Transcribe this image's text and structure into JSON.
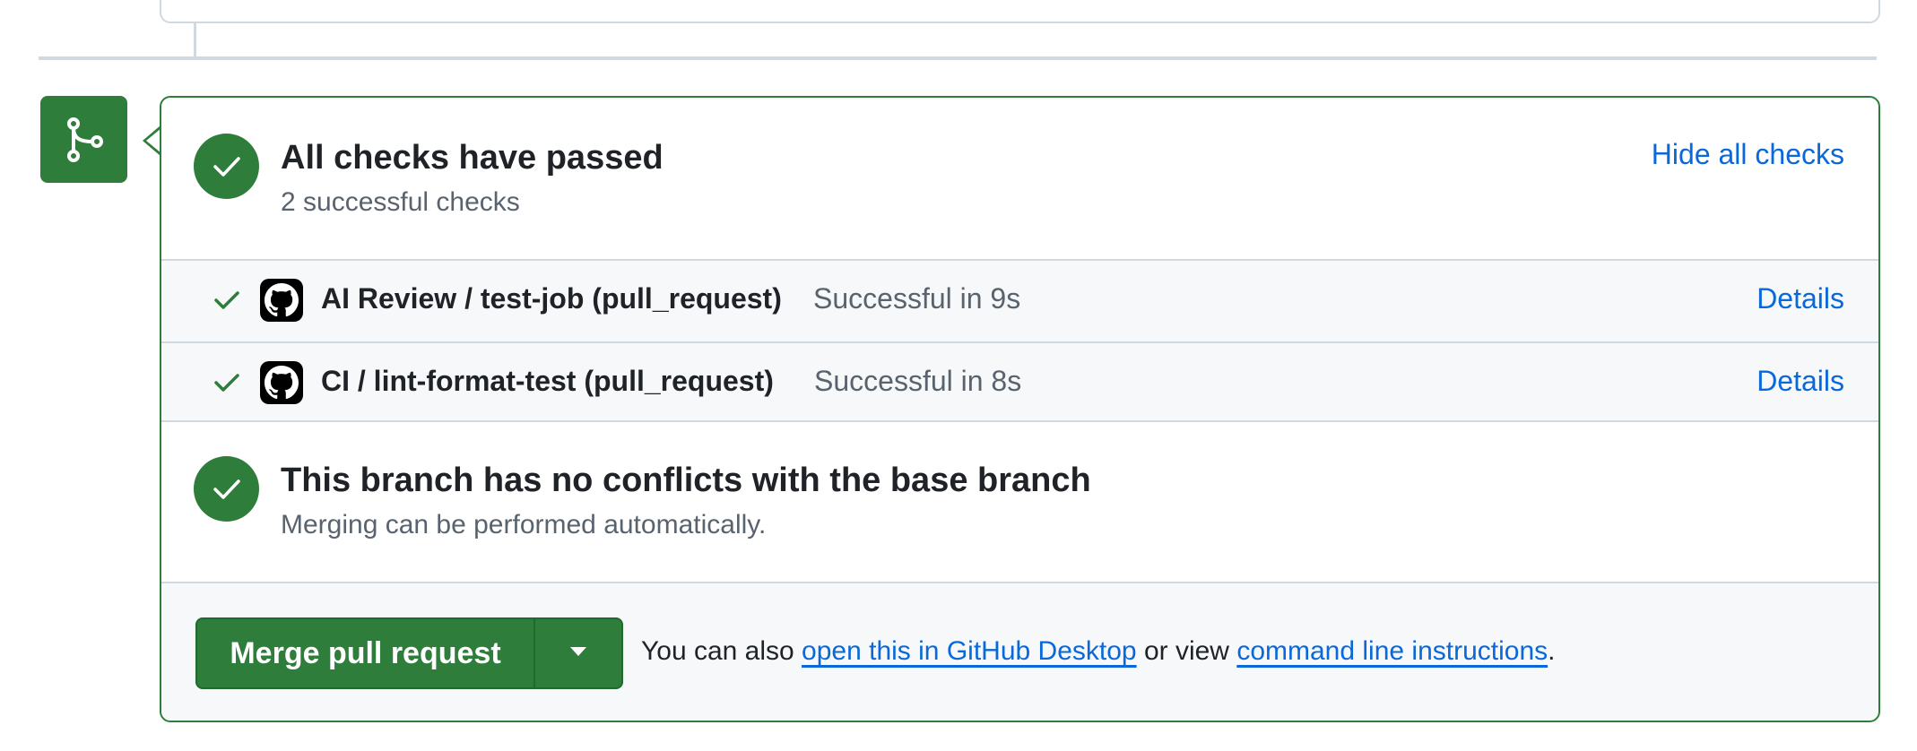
{
  "checks": {
    "title": "All checks have passed",
    "subtitle": "2 successful checks",
    "toggle_label": "Hide all checks",
    "items": [
      {
        "name": "AI Review / test-job (pull_request)",
        "status": "Successful in 9s",
        "details_label": "Details"
      },
      {
        "name": "CI / lint-format-test (pull_request)",
        "status": "Successful in 8s",
        "details_label": "Details"
      }
    ]
  },
  "conflicts": {
    "title": "This branch has no conflicts with the base branch",
    "subtitle": "Merging can be performed automatically."
  },
  "merge": {
    "button_label": "Merge pull request",
    "note_prefix": "You can also",
    "desktop_link": "open this in GitHub Desktop",
    "note_middle": "or view",
    "cli_link": "command line instructions",
    "note_suffix": "."
  },
  "colors": {
    "success": "#2f7d3b",
    "link": "#0969da",
    "muted_text": "#59636e",
    "border": "#d1d9e0"
  },
  "icons": {
    "merge_badge": "git-merge-icon",
    "check": "check-icon",
    "check_circle": "check-circle-icon",
    "app_logo": "github-logo-icon",
    "dropdown": "triangle-down-icon"
  }
}
